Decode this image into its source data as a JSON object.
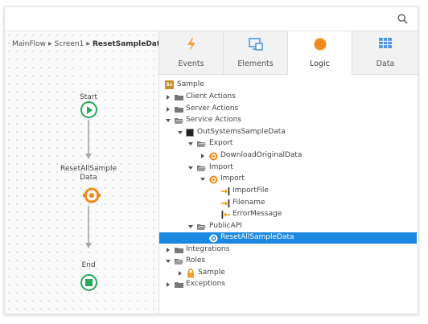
{
  "breadcrumb": {
    "item1": "MainFlow",
    "item2": "Screen1",
    "current": "ResetSampleData"
  },
  "flow": {
    "start_label": "Start",
    "action_label_line1": "ResetAllSample",
    "action_label_line2": "Data",
    "end_label": "End"
  },
  "tabs": [
    {
      "label": "Events",
      "icon": "lightning-icon",
      "active": false
    },
    {
      "label": "Elements",
      "icon": "screen-icon",
      "active": false
    },
    {
      "label": "Logic",
      "icon": "circle-icon",
      "active": true
    },
    {
      "label": "Data",
      "icon": "table-icon",
      "active": false
    }
  ],
  "tree": {
    "root": "Sample",
    "root_badge": "Sc",
    "client_actions": "Client Actions",
    "server_actions": "Server Actions",
    "service_actions": "Service Actions",
    "module": "OutSystemsSampleData",
    "export": "Export",
    "download": "DownloadOriginalData",
    "import_folder": "Import",
    "import_action": "Import",
    "param1": "ImportFile",
    "param2": "Filename",
    "param3": "ErrorMessage",
    "public_api": "PublicAPI",
    "reset": "ResetAllSampleData",
    "integrations": "Integrations",
    "roles": "Roles",
    "role_sample": "Sample",
    "exceptions": "Exceptions"
  },
  "colors": {
    "accent_green": "#27a85a",
    "accent_orange": "#f08a1c",
    "selection_blue": "#1a88e0"
  }
}
